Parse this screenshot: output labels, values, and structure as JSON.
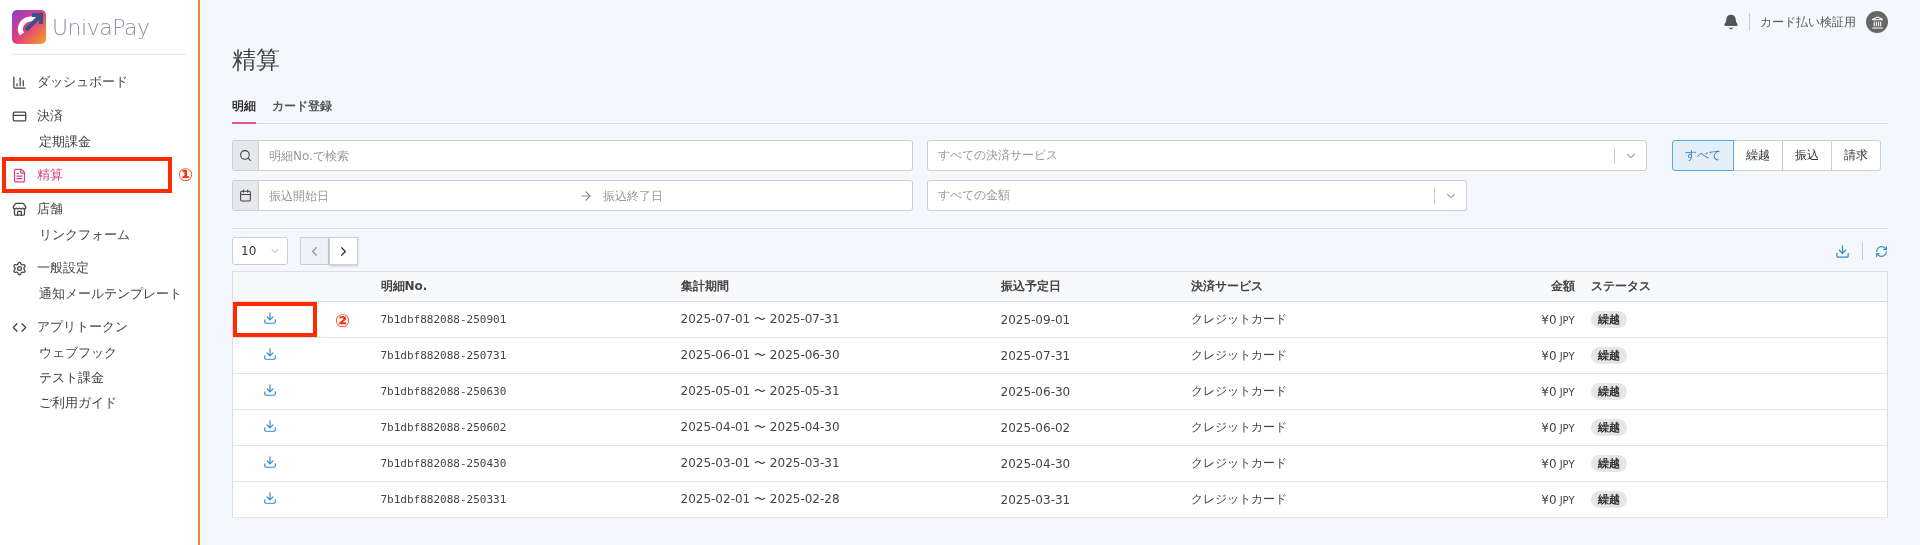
{
  "logo": {
    "text": "UnivaPay"
  },
  "sidebar": {
    "items": [
      {
        "label": "ダッシュボード",
        "selected": false
      },
      {
        "label": "決済",
        "selected": false,
        "children": [
          {
            "label": "定期課金",
            "selected": false
          }
        ]
      },
      {
        "label": "精算",
        "selected": true,
        "annotation": "①"
      },
      {
        "label": "店舗",
        "selected": false,
        "children": [
          {
            "label": "リンクフォーム",
            "selected": false
          }
        ]
      },
      {
        "label": "一般設定",
        "selected": false,
        "children": [
          {
            "label": "通知メールテンプレート",
            "selected": false
          }
        ]
      },
      {
        "label": "アプリトークン",
        "selected": false,
        "children": [
          {
            "label": "ウェブフック",
            "selected": false
          },
          {
            "label": "テスト課金",
            "selected": false
          },
          {
            "label": "ご利用ガイド",
            "selected": false
          }
        ]
      }
    ]
  },
  "header": {
    "account": "カード払い検証用"
  },
  "page_title": "精算",
  "tabs": [
    {
      "label": "明細",
      "selected": true
    },
    {
      "label": "カード登録",
      "selected": false
    }
  ],
  "filters": {
    "search": {
      "placeholder": "明細No.で検索"
    },
    "service": {
      "placeholder": "すべての決済サービス"
    },
    "date_from": {
      "placeholder": "振込開始日"
    },
    "date_to": {
      "placeholder": "振込終了日"
    },
    "amount": {
      "placeholder": "すべての金額"
    },
    "segments": [
      {
        "label": "すべて",
        "selected": true
      },
      {
        "label": "繰越",
        "selected": false
      },
      {
        "label": "振込",
        "selected": false
      },
      {
        "label": "請求",
        "selected": false
      }
    ]
  },
  "pagination": {
    "page_size": "10",
    "buttons": [
      {
        "kind": "prev",
        "disabled": true
      },
      {
        "kind": "next",
        "disabled": false
      }
    ]
  },
  "table": {
    "columns": [
      "明細No.",
      "集計期間",
      "振込予定日",
      "決済サービス",
      "金額",
      "ステータス"
    ],
    "rows": [
      {
        "number": "7b1dbf882088-250901",
        "period": "2025-07-01 〜 2025-07-31",
        "date": "2025-09-01",
        "service": "クレジットカード",
        "amount": "¥0",
        "currency": "JPY",
        "status": "繰越",
        "annotation": "②"
      },
      {
        "number": "7b1dbf882088-250731",
        "period": "2025-06-01 〜 2025-06-30",
        "date": "2025-07-31",
        "service": "クレジットカード",
        "amount": "¥0",
        "currency": "JPY",
        "status": "繰越"
      },
      {
        "number": "7b1dbf882088-250630",
        "period": "2025-05-01 〜 2025-05-31",
        "date": "2025-06-30",
        "service": "クレジットカード",
        "amount": "¥0",
        "currency": "JPY",
        "status": "繰越"
      },
      {
        "number": "7b1dbf882088-250602",
        "period": "2025-04-01 〜 2025-04-30",
        "date": "2025-06-02",
        "service": "クレジットカード",
        "amount": "¥0",
        "currency": "JPY",
        "status": "繰越"
      },
      {
        "number": "7b1dbf882088-250430",
        "period": "2025-03-01 〜 2025-03-31",
        "date": "2025-04-30",
        "service": "クレジットカード",
        "amount": "¥0",
        "currency": "JPY",
        "status": "繰越"
      },
      {
        "number": "7b1dbf882088-250331",
        "period": "2025-02-01 〜 2025-02-28",
        "date": "2025-03-31",
        "service": "クレジットカード",
        "amount": "¥0",
        "currency": "JPY",
        "status": "繰越"
      }
    ]
  }
}
